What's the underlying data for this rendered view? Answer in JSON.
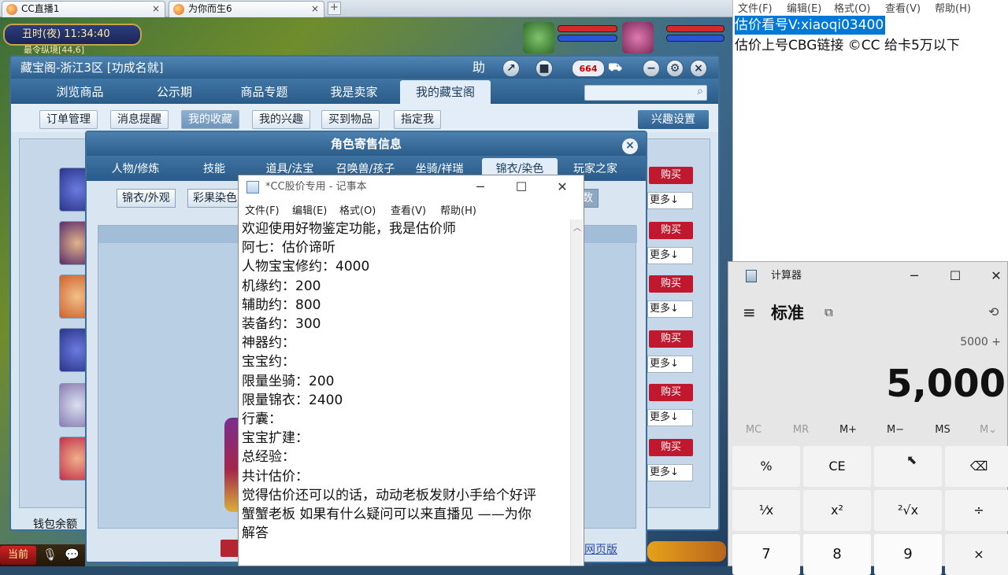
{
  "browser": {
    "tabs": [
      {
        "label": "CC直播1",
        "close": "×"
      },
      {
        "label": "为你而生6",
        "close": "×"
      }
    ],
    "new_tab": "+"
  },
  "game": {
    "time": "丑时(夜)  11:34:40",
    "location": "最令纵境[44,6]",
    "bottom_left": "当前"
  },
  "cbg": {
    "title": "藏宝阁-浙江3区 [功成名就]",
    "help": "助",
    "notification_count": "664",
    "nav_tabs": [
      "浏览商品",
      "公示期",
      "商品专题",
      "我是卖家",
      "我的藏宝阁"
    ],
    "sub_buttons": [
      "订单管理",
      "消息提醒",
      "我的收藏",
      "我的兴趣",
      "买到物品",
      "指定我"
    ],
    "interest_button": "兴趣设置",
    "row_buy": "购买",
    "row_more": "更多↓",
    "wallet": "钱包余额",
    "web_version": "网页版"
  },
  "dialog": {
    "title": "角色寄售信息",
    "tabs": [
      "人物/修炼",
      "技能",
      "道具/法宝",
      "召唤兽/孩子",
      "坐骑/祥瑞",
      "锦衣/染色",
      "玩家之家"
    ],
    "sub_buttons": [
      "锦衣/外观",
      "彩果染色"
    ],
    "partial_button": "数"
  },
  "notepad": {
    "title": "*CC股价专用 - 记事本",
    "menu": [
      "文件(F)",
      "编辑(E)",
      "格式(O)",
      "查看(V)",
      "帮助(H)"
    ],
    "lines": [
      "欢迎使用好物鉴定功能，我是估价师",
      "阿七：估价谛听",
      "人物宝宝修约：4000",
      "机缘约：200",
      "辅助约：800",
      "装备约：300",
      "神器约：",
      "宝宝约：",
      "限量坐骑：200",
      "限量锦衣：2400",
      "行囊：",
      "宝宝扩建：",
      "总经验：",
      "共计估价：",
      "觉得估价还可以的话，动动老板发财小手给个好评",
      "蟹蟹老板 如果有什么疑问可以来直播见 ——为你",
      "解答"
    ]
  },
  "notepad2": {
    "menu": [
      "文件(F)",
      "编辑(E)",
      "格式(O)",
      "查看(V)",
      "帮助(H)"
    ],
    "line1": "估价看号V:xiaoqi03400",
    "line2": "估价上号CBG链接 ©CC 给卡5万以下"
  },
  "calculator": {
    "title": "计算器",
    "mode": "标准",
    "expression": "5000 +",
    "display": "5,000",
    "memory": [
      "MC",
      "MR",
      "M+",
      "M−",
      "MS",
      "M⌄"
    ],
    "keys_row1": [
      "%",
      "CE",
      "C",
      "⌫"
    ],
    "keys_row2": [
      "¹⁄x",
      "x²",
      "²√x",
      "÷"
    ],
    "keys_row3": [
      "7",
      "8",
      "9",
      "×"
    ]
  }
}
